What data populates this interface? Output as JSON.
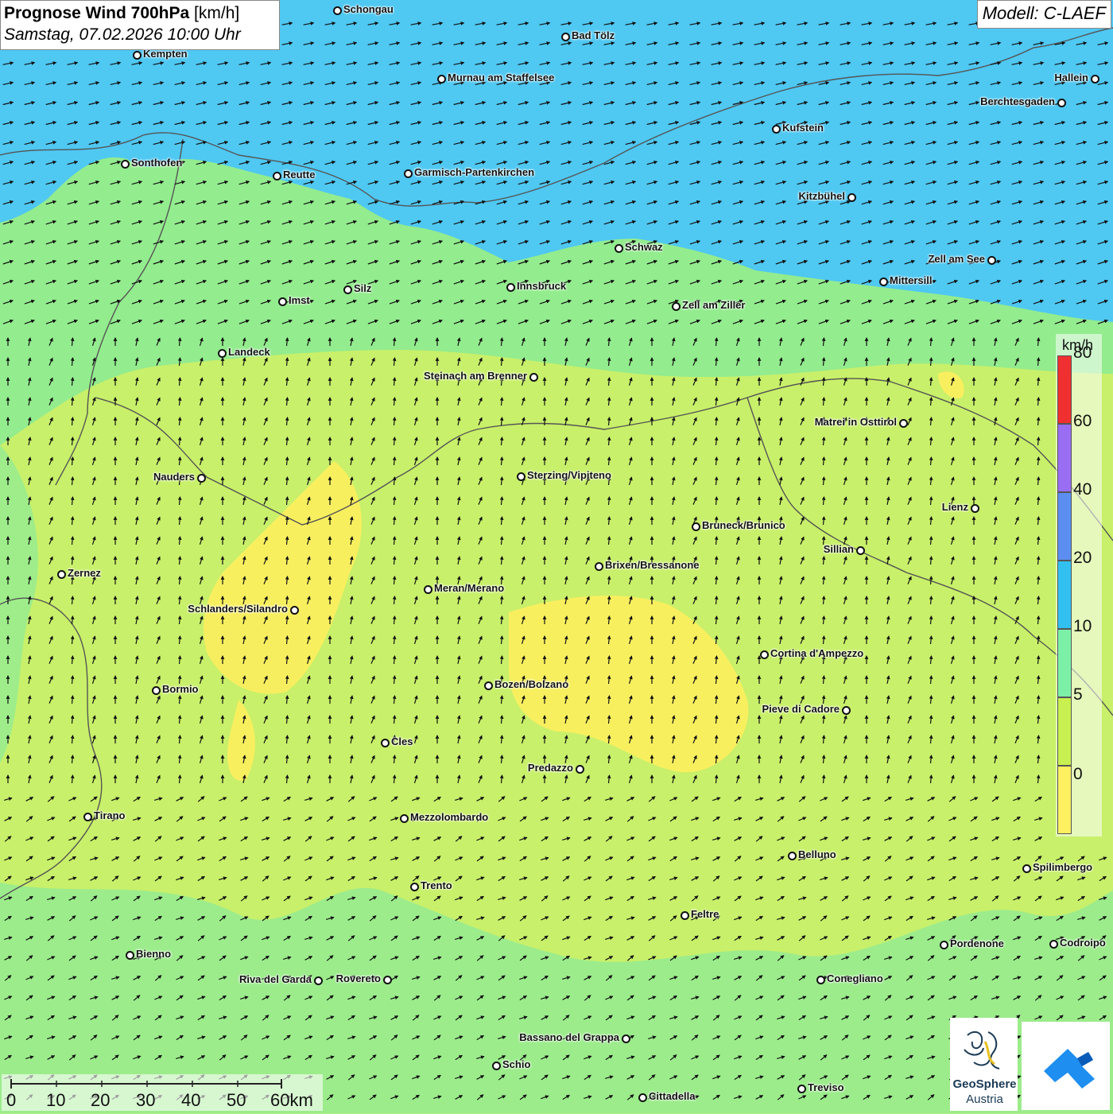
{
  "title": {
    "main_bold": "Prognose Wind 700hPa",
    "unit": "[km/h]",
    "datetime": "Samstag, 07.02.2026 10:00 Uhr"
  },
  "model": "Modell: C-LAEF",
  "legend": {
    "unit": "km/h",
    "labels": [
      "80",
      "60",
      "40",
      "20",
      "10",
      "5",
      "0"
    ],
    "colors": [
      "#f03030",
      "#9a6ef2",
      "#5b8ef0",
      "#32c0f0",
      "#7df0a8",
      "#c8f050",
      "#fff060"
    ]
  },
  "scale": {
    "labels": [
      "0",
      "10",
      "20",
      "30",
      "40",
      "50",
      "60km"
    ]
  },
  "branding": {
    "org_line1": "GeoSphere",
    "org_line2": "Austria"
  },
  "cities": [
    {
      "name": "Schongau"
    },
    {
      "name": "Bad Tölz"
    },
    {
      "name": "Kempten"
    },
    {
      "name": "Murnau am Staffelsee"
    },
    {
      "name": "Hallein"
    },
    {
      "name": "Berchtesgaden"
    },
    {
      "name": "Kufstein"
    },
    {
      "name": "Sonthofen"
    },
    {
      "name": "Reutte"
    },
    {
      "name": "Garmisch-Partenkirchen"
    },
    {
      "name": "Kitzbühel"
    },
    {
      "name": "Schwaz"
    },
    {
      "name": "Zell am See"
    },
    {
      "name": "Mittersill"
    },
    {
      "name": "Innsbruck"
    },
    {
      "name": "Silz"
    },
    {
      "name": "Imst"
    },
    {
      "name": "Zell am Ziller"
    },
    {
      "name": "Landeck"
    },
    {
      "name": "Steinach am Brenner"
    },
    {
      "name": "Matrei in Osttirol"
    },
    {
      "name": "Nauders"
    },
    {
      "name": "Sterzing/Vipiteno"
    },
    {
      "name": "Lienz"
    },
    {
      "name": "Bruneck/Brunico"
    },
    {
      "name": "Sillian"
    },
    {
      "name": "Zernez"
    },
    {
      "name": "Brixen/Bressanone"
    },
    {
      "name": "Meran/Merano"
    },
    {
      "name": "Schlanders/Silandro"
    },
    {
      "name": "Cortina d'Ampezzo"
    },
    {
      "name": "Bozen/Bolzano"
    },
    {
      "name": "Bormio"
    },
    {
      "name": "Pieve di Cadore"
    },
    {
      "name": "Cles"
    },
    {
      "name": "Predazzo"
    },
    {
      "name": "Tirano"
    },
    {
      "name": "Mezzolombardo"
    },
    {
      "name": "Belluno"
    },
    {
      "name": "Spilimbergo"
    },
    {
      "name": "Trento"
    },
    {
      "name": "Feltre"
    },
    {
      "name": "Bienno"
    },
    {
      "name": "Pordenone"
    },
    {
      "name": "Codroipo"
    },
    {
      "name": "Riva del Garda"
    },
    {
      "name": "Rovereto"
    },
    {
      "name": "Conegliano"
    },
    {
      "name": "Bassano del Grappa"
    },
    {
      "name": "Schio"
    },
    {
      "name": "Treviso"
    },
    {
      "name": "Cittadella"
    }
  ]
}
